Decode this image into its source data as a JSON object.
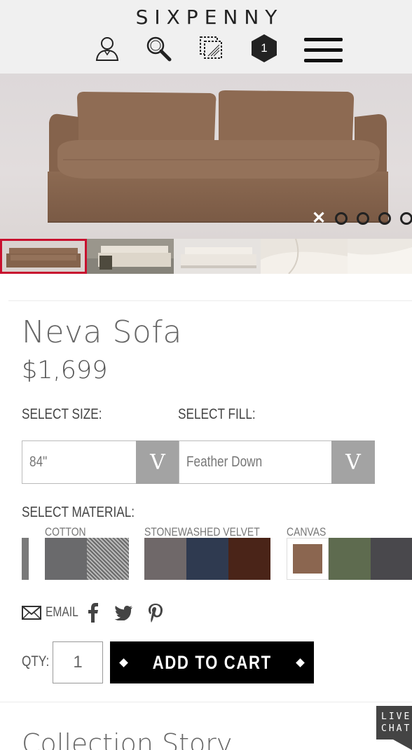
{
  "header": {
    "logo": "SIXPENNY",
    "cart_count": "1",
    "icons": [
      "account-icon",
      "search-icon",
      "swatches-icon",
      "cart-icon",
      "menu-icon"
    ]
  },
  "hero": {
    "slides": 5,
    "active_slide": 1
  },
  "thumbnails": [
    "thumb-sofa-brown",
    "thumb-sofa-white-blanket",
    "thumb-sofa-white",
    "thumb-sofa-closeup",
    "thumb-sofa-closeup-2"
  ],
  "product": {
    "name": "Neva Sofa",
    "price": "$1,699"
  },
  "options": {
    "size_label": "SELECT SIZE:",
    "size_value": "84\"",
    "fill_label": "SELECT FILL:",
    "fill_value": "Feather Down",
    "arrow": "V",
    "material_label": "SELECT MATERIAL:",
    "groups": [
      {
        "name": "COTTON",
        "swatches": [
          "#6a6a6c",
          "#8a8a8a"
        ]
      },
      {
        "name": "STONEWASHED VELVET",
        "swatches": [
          "#6f6869",
          "#2f3a50",
          "#4a2418"
        ]
      },
      {
        "name": "CANVAS",
        "swatches": [
          "#8b6650",
          "#5e6b4f",
          "#49484c"
        ]
      }
    ],
    "selected_material": "CANVAS brown"
  },
  "share": {
    "email_label": "EMAIL"
  },
  "purchase": {
    "qty_label": "QTY:",
    "qty_value": "1",
    "add_to_cart": "ADD TO CART"
  },
  "section": {
    "title": "Collection Story"
  },
  "livechat": {
    "line1": "LIVE",
    "line2": "CHAT"
  },
  "colors": {
    "header_bg": "#f0f0f0",
    "selected_thumb_border": "#c8102e",
    "button_bg": "#000000",
    "select_arrow_bg": "#a3a3a3"
  }
}
